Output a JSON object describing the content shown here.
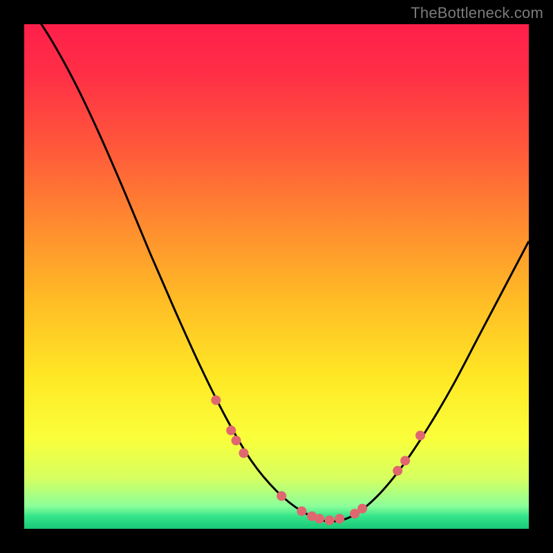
{
  "watermark": "TheBottleneck.com",
  "chart_data": {
    "type": "line",
    "title": "",
    "xlabel": "",
    "ylabel": "",
    "xlim": [
      0,
      1
    ],
    "ylim": [
      0,
      1
    ],
    "series": [
      {
        "name": "curve",
        "x": [
          0.0,
          0.05,
          0.1,
          0.15,
          0.2,
          0.25,
          0.3,
          0.35,
          0.4,
          0.45,
          0.5,
          0.55,
          0.6,
          0.65,
          0.7,
          0.75,
          0.8,
          0.85,
          0.9,
          0.95,
          1.0
        ],
        "y": [
          1.05,
          0.975,
          0.885,
          0.78,
          0.665,
          0.545,
          0.43,
          0.32,
          0.22,
          0.135,
          0.075,
          0.035,
          0.015,
          0.025,
          0.065,
          0.125,
          0.2,
          0.285,
          0.38,
          0.475,
          0.57
        ],
        "color": "#000000"
      }
    ],
    "points": {
      "name": "highlight",
      "x": [
        0.38,
        0.41,
        0.42,
        0.435,
        0.51,
        0.55,
        0.57,
        0.585,
        0.605,
        0.625,
        0.655,
        0.67,
        0.74,
        0.755,
        0.785
      ],
      "y": [
        0.255,
        0.195,
        0.175,
        0.15,
        0.065,
        0.035,
        0.025,
        0.02,
        0.017,
        0.02,
        0.03,
        0.04,
        0.115,
        0.135,
        0.185
      ],
      "color": "#e06670",
      "radius": 7
    },
    "background_gradient": {
      "stops": [
        {
          "pos": 0.0,
          "color": "#ff1f4a"
        },
        {
          "pos": 0.1,
          "color": "#ff2f46"
        },
        {
          "pos": 0.25,
          "color": "#ff5a3a"
        },
        {
          "pos": 0.4,
          "color": "#ff8c2f"
        },
        {
          "pos": 0.55,
          "color": "#ffbd25"
        },
        {
          "pos": 0.7,
          "color": "#ffe825"
        },
        {
          "pos": 0.82,
          "color": "#faff3a"
        },
        {
          "pos": 0.9,
          "color": "#d6ff60"
        },
        {
          "pos": 0.955,
          "color": "#8bff9a"
        },
        {
          "pos": 0.975,
          "color": "#35e58a"
        },
        {
          "pos": 1.0,
          "color": "#19c877"
        }
      ]
    }
  }
}
